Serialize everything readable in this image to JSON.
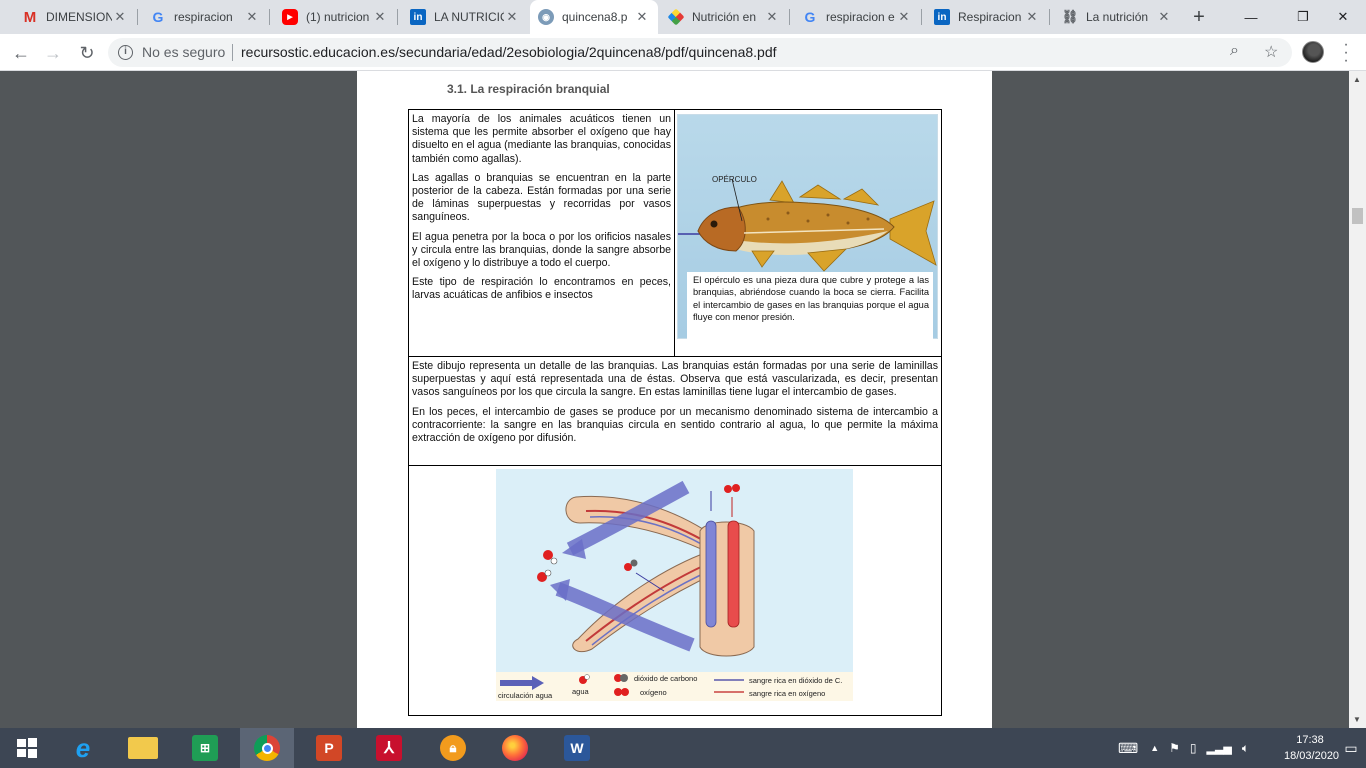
{
  "tabs": [
    {
      "title": "DIMENSION",
      "icon": "gmail-icon"
    },
    {
      "title": "respiracion",
      "icon": "google-icon"
    },
    {
      "title": "(1) nutricion",
      "icon": "youtube-icon"
    },
    {
      "title": "LA NUTRICIÓ",
      "icon": "linkedin-icon"
    },
    {
      "title": "quincena8.p",
      "icon": "globe-icon"
    },
    {
      "title": "Nutrición en",
      "icon": "colorful-site-icon"
    },
    {
      "title": "respiracion e",
      "icon": "google-icon"
    },
    {
      "title": "Respiracion",
      "icon": "linkedin-icon"
    },
    {
      "title": "La nutrición",
      "icon": "link-icon"
    }
  ],
  "active_tab": 4,
  "address": {
    "security_label": "No es seguro",
    "url": "recursostic.educacion.es/secundaria/edad/2esobiologia/2quincena8/pdf/quincena8.pdf"
  },
  "document": {
    "section_title": "3.1. La respiración branquial",
    "left_paragraphs": [
      "La mayoría de los animales acuáticos tienen un sistema que les permite absorber el oxígeno que hay disuelto en el agua (mediante las branquias, conocidas también como agallas).",
      "Las agallas o branquias se encuentran en la parte posterior de la cabeza. Están formadas por una serie de láminas superpuestas y recorridas por vasos sanguíneos.",
      "El agua penetra por la boca o por los orificios nasales y circula entre las branquias, donde la sangre absorbe el oxígeno y lo distribuye a todo el cuerpo.",
      "Este tipo de respiración lo encontramos en peces, larvas acuáticas de anfibios e insectos"
    ],
    "fish_label": "OPÉRCULO",
    "fish_caption": "El opérculo es una pieza dura que cubre y protege a las branquias, abriéndose cuando la boca se cierra. Facilita el intercambio de gases en las branquias porque el agua fluye con menor presión.",
    "middle_paragraphs": [
      "Este dibujo representa un detalle de las branquias. Las branquias están formadas por una serie de laminillas superpuestas y aquí está representada una de éstas. Observa que está vascularizada, es decir, presentan vasos sanguíneos por los que circula la sangre. En estas laminillas tiene lugar el intercambio de gases.",
      "En los peces, el intercambio de gases se produce por un mecanismo denominado sistema de intercambio a contracorriente: la sangre en las branquias circula en sentido contrario al agua, lo que permite la máxima extracción de oxígeno por difusión."
    ],
    "legend": {
      "water_flow": "circulación agua",
      "water": "agua",
      "co2": "dióxido de carbono",
      "oxygen": "oxígeno",
      "blood_co2": "sangre rica en dióxido de C.",
      "blood_o2": "sangre rica en oxígeno"
    }
  },
  "taskbar": {
    "time": "17:38",
    "date": "18/03/2020"
  },
  "colors": {
    "tab_bar": "#dee1e6",
    "viewer_bg": "#525659",
    "taskbar": "#3d4654",
    "vein_blue": "#7f85d6",
    "artery_red": "#e84c4c",
    "gill_tan": "#f0c9a6"
  }
}
